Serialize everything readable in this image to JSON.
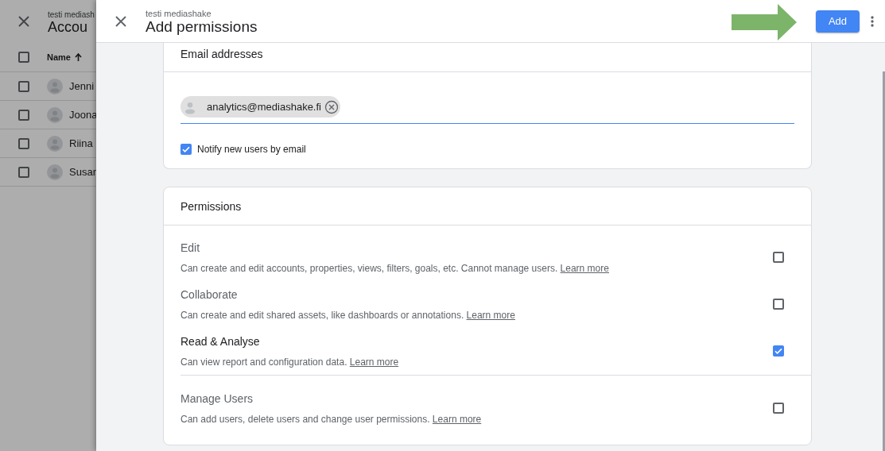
{
  "background": {
    "subtitle": "testi mediash",
    "title": "Accou",
    "column": "Name",
    "select_all_checked": false,
    "rows": [
      {
        "name": "Jenni",
        "checked": false
      },
      {
        "name": "Joona",
        "checked": false
      },
      {
        "name": "Riina",
        "checked": false
      },
      {
        "name": "Susan",
        "checked": false
      }
    ]
  },
  "drawer": {
    "subtitle": "testi mediashake",
    "title": "Add permissions",
    "add_button": "Add"
  },
  "email_card": {
    "title": "Email addresses",
    "chips": [
      "analytics@mediashake.fi"
    ],
    "notify": {
      "label": "Notify new users by email",
      "checked": true
    }
  },
  "permissions_card": {
    "title": "Permissions",
    "items": [
      {
        "name": "Edit",
        "description": "Can create and edit accounts, properties, views, filters, goals, etc. Cannot manage users.",
        "link": "Learn more",
        "checked": false
      },
      {
        "name": "Collaborate",
        "description": "Can create and edit shared assets, like dashboards or annotations.",
        "link": "Learn more",
        "checked": false
      },
      {
        "name": "Read & Analyse",
        "description": "Can view report and configuration data.",
        "link": "Learn more",
        "checked": true
      },
      {
        "name": "Manage Users",
        "description": "Can add users, delete users and change user permissions.",
        "link": "Learn more",
        "checked": false
      }
    ]
  }
}
